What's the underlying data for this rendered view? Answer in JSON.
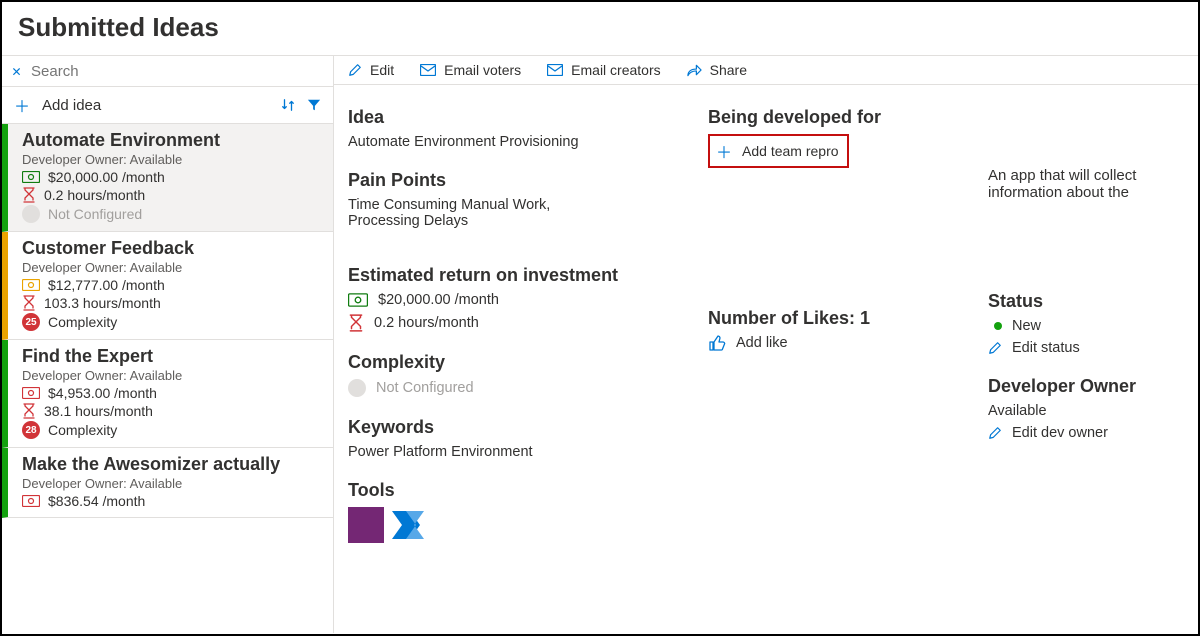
{
  "page_title": "Submitted Ideas",
  "search": {
    "placeholder": "Search"
  },
  "add_idea_label": "Add idea",
  "ideas": [
    {
      "title": "Automate Environment",
      "owner_line": "Developer Owner: Available",
      "money": "$20,000.00 /month",
      "hours": "0.2 hours/month",
      "complexity_label": "Not Configured",
      "complexity_num": "",
      "color": "green",
      "selected": true,
      "money_color": "money-green"
    },
    {
      "title": "Customer Feedback",
      "owner_line": "Developer Owner: Available",
      "money": "$12,777.00 /month",
      "hours": "103.3 hours/month",
      "complexity_label": "Complexity",
      "complexity_num": "25",
      "color": "yellow",
      "selected": false,
      "money_color": "money-yellow"
    },
    {
      "title": "Find the Expert",
      "owner_line": "Developer Owner: Available",
      "money": "$4,953.00 /month",
      "hours": "38.1 hours/month",
      "complexity_label": "Complexity",
      "complexity_num": "28",
      "color": "green",
      "selected": false,
      "money_color": "money-red"
    },
    {
      "title": "Make the Awesomizer actually",
      "owner_line": "Developer Owner: Available",
      "money": "$836.54 /month",
      "hours": "",
      "complexity_label": "",
      "complexity_num": "",
      "color": "green",
      "selected": false,
      "money_color": "money-red"
    }
  ],
  "toolbar": {
    "edit": "Edit",
    "email_voters": "Email voters",
    "email_creators": "Email creators",
    "share": "Share"
  },
  "detail": {
    "idea_h": "Idea",
    "idea_v": "Automate Environment Provisioning",
    "pain_h": "Pain Points",
    "pain_v": "Time Consuming Manual Work, Processing Delays",
    "roi_h": "Estimated return on investment",
    "roi_money": "$20,000.00 /month",
    "roi_hours": "0.2 hours/month",
    "complexity_h": "Complexity",
    "complexity_v": "Not Configured",
    "keywords_h": "Keywords",
    "keywords_v": "Power Platform Environment",
    "tools_h": "Tools",
    "being_dev_h": "Being developed for",
    "add_team": "Add team repro",
    "likes_h": "Number of Likes: 1",
    "add_like": "Add like",
    "status_h": "Status",
    "status_v": "New",
    "edit_status": "Edit status",
    "dev_owner_h": "Developer Owner",
    "dev_owner_v": "Available",
    "edit_dev_owner": "Edit dev owner",
    "description": "An app that will collect information about the"
  },
  "colors": {
    "primary": "#0078d4",
    "green": "#13a10e",
    "red": "#d13438"
  }
}
